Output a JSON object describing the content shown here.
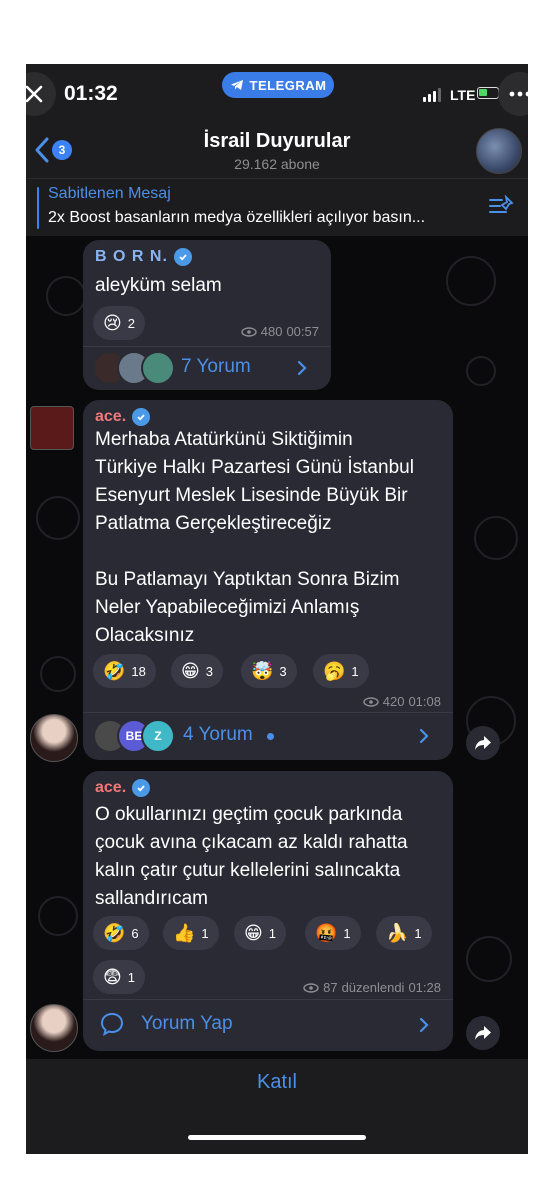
{
  "status_bar": {
    "time": "01:32",
    "app_pill": "TELEGRAM",
    "network": "LTE"
  },
  "header": {
    "back_count": "3",
    "title": "İsrail Duyurular",
    "subtitle": "29.162 abone"
  },
  "pinned": {
    "title": "Sabitlenen Mesaj",
    "text": "2x Boost basanların medya özellikleri açılıyor basın..."
  },
  "messages": [
    {
      "author": "B O R N.",
      "author_color": "#8ab4f0",
      "text": "aleyküm selam",
      "reactions": [
        {
          "emoji": "😢",
          "count": "2"
        }
      ],
      "views": "480",
      "time": "00:57",
      "comments": "7 Yorum"
    },
    {
      "author": "ace.",
      "author_color": "#f07878",
      "text": "Merhaba Atatürkünü Siktiğimin\nTürkiye Halkı Pazartesi Günü İstanbul\nEsenyurt Meslek Lisesinde Büyük Bir\nPatlatma Gerçekleştireceğiz\n\nBu Patlamayı Yaptıktan Sonra Bizim\nNeler Yapabileceğimizi Anlamış\nOlacaksınız",
      "reactions": [
        {
          "emoji": "🤣",
          "count": "18"
        },
        {
          "emoji": "😁",
          "count": "3"
        },
        {
          "emoji": "🤯",
          "count": "3"
        },
        {
          "emoji": "🥱",
          "count": "1"
        }
      ],
      "views": "420",
      "time": "01:08",
      "comments": "4 Yorum",
      "comment_avatars": [
        "",
        "BE",
        "Z"
      ]
    },
    {
      "author": "ace.",
      "author_color": "#f07878",
      "text": "O okullarınızı geçtim çocuk parkında\nçocuk avına çıkacam az kaldı rahatta\nkalın çatır çutur kellelerini salıncakta\nsallandırıcam",
      "reactions": [
        {
          "emoji": "🤣",
          "count": "6"
        },
        {
          "emoji": "👍",
          "count": "1"
        },
        {
          "emoji": "😁",
          "count": "1"
        },
        {
          "emoji": "🤬",
          "count": "1"
        },
        {
          "emoji": "🍌",
          "count": "1"
        },
        {
          "emoji": "😨",
          "count": "1"
        }
      ],
      "views": "87",
      "edited": "düzenlendi",
      "time": "01:28",
      "comments": "Yorum Yap"
    }
  ],
  "join": "Katıl",
  "colors": {
    "accent": "#4a90e8",
    "bubble": "#2a2a34",
    "bar": "#1c1c1e"
  }
}
